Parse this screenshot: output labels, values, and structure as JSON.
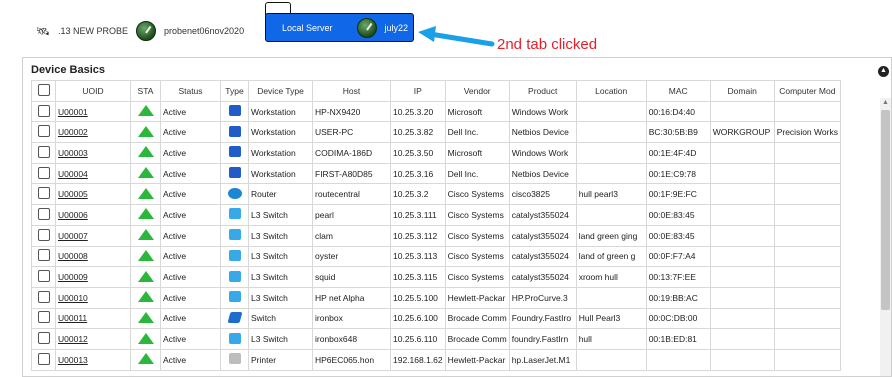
{
  "tabs": [
    {
      "label": ".13 NEW PROBE",
      "icon": "satellite-icon"
    },
    {
      "label": "probenet06nov2020",
      "icon": "gauge-icon"
    },
    {
      "label_left": "Local Server",
      "label_right": "july22",
      "icon": "gauge-icon",
      "active": true
    }
  ],
  "annotation": {
    "text": "2nd tab clicked",
    "color": "#e6202a",
    "arrow_color": "#1aa0e8"
  },
  "panel": {
    "title": "Device Basics"
  },
  "columns": [
    "UOID",
    "STA",
    "Status",
    "Type",
    "Device Type",
    "Host",
    "IP",
    "Vendor",
    "Product",
    "Location",
    "MAC",
    "Domain",
    "Computer Mod"
  ],
  "rows": [
    {
      "uoid": "U00001",
      "status": "Active",
      "type_icon": "workstation-icon",
      "device_type": "Workstation",
      "host": "HP-NX9420",
      "ip": "10.25.3.20",
      "vendor": "Microsoft",
      "product": "Windows Work",
      "location": "",
      "mac": "00:16:D4:40",
      "domain": "",
      "model": ""
    },
    {
      "uoid": "U00002",
      "status": "Active",
      "type_icon": "workstation-icon",
      "device_type": "Workstation",
      "host": "USER-PC",
      "ip": "10.25.3.82",
      "vendor": "Dell Inc.",
      "product": "Netbios Device",
      "location": "",
      "mac": "BC:30:5B:B9",
      "domain": "WORKGROUP",
      "model": "Precision Works"
    },
    {
      "uoid": "U00003",
      "status": "Active",
      "type_icon": "workstation-icon",
      "device_type": "Workstation",
      "host": "CODIMA-186D",
      "ip": "10.25.3.50",
      "vendor": "Microsoft",
      "product": "Windows Work",
      "location": "",
      "mac": "00:1E:4F:4D",
      "domain": "",
      "model": ""
    },
    {
      "uoid": "U00004",
      "status": "Active",
      "type_icon": "workstation-icon",
      "device_type": "Workstation",
      "host": "FIRST-A80D85",
      "ip": "10.25.3.16",
      "vendor": "Dell Inc.",
      "product": "Netbios Device",
      "location": "",
      "mac": "00:1E:C9:78",
      "domain": "",
      "model": ""
    },
    {
      "uoid": "U00005",
      "status": "Active",
      "type_icon": "router-icon",
      "device_type": "Router",
      "host": "routecentral",
      "ip": "10.25.3.2",
      "vendor": "Cisco Systems",
      "product": "cisco3825",
      "location": "hull pearl3",
      "mac": "00:1F:9E:FC",
      "domain": "",
      "model": ""
    },
    {
      "uoid": "U00006",
      "status": "Active",
      "type_icon": "l3-switch-icon",
      "device_type": "L3 Switch",
      "host": "pearl",
      "ip": "10.25.3.111",
      "vendor": "Cisco Systems",
      "product": "catalyst355024",
      "location": "",
      "mac": "00:0E:83:45",
      "domain": "",
      "model": ""
    },
    {
      "uoid": "U00007",
      "status": "Active",
      "type_icon": "l3-switch-icon",
      "device_type": "L3 Switch",
      "host": "clam",
      "ip": "10.25.3.112",
      "vendor": "Cisco Systems",
      "product": "catalyst355024",
      "location": "land green ging",
      "mac": "00:0E:83:45",
      "domain": "",
      "model": ""
    },
    {
      "uoid": "U00008",
      "status": "Active",
      "type_icon": "l3-switch-icon",
      "device_type": "L3 Switch",
      "host": "oyster",
      "ip": "10.25.3.113",
      "vendor": "Cisco Systems",
      "product": "catalyst355024",
      "location": "land of green g",
      "mac": "00:0F:F7:A4",
      "domain": "",
      "model": ""
    },
    {
      "uoid": "U00009",
      "status": "Active",
      "type_icon": "l3-switch-icon",
      "device_type": "L3 Switch",
      "host": "squid",
      "ip": "10.25.3.115",
      "vendor": "Cisco Systems",
      "product": "catalyst355024",
      "location": "xroom hull",
      "mac": "00:13:7F:EE",
      "domain": "",
      "model": ""
    },
    {
      "uoid": "U00010",
      "status": "Active",
      "type_icon": "l3-switch-icon",
      "device_type": "L3 Switch",
      "host": "HP net Alpha",
      "ip": "10.25.5.100",
      "vendor": "Hewlett-Packar",
      "product": "HP.ProCurve.3",
      "location": "",
      "mac": "00:19:BB:AC",
      "domain": "",
      "model": ""
    },
    {
      "uoid": "U00011",
      "status": "Active",
      "type_icon": "switch-icon",
      "device_type": "Switch",
      "host": "ironbox",
      "ip": "10.25.6.100",
      "vendor": "Brocade Comm",
      "product": "Foundry.FastIro",
      "location": "Hull Pearl3",
      "mac": "00:0C:DB:00",
      "domain": "",
      "model": ""
    },
    {
      "uoid": "U00012",
      "status": "Active",
      "type_icon": "l3-switch-icon",
      "device_type": "L3 Switch",
      "host": "ironbox648",
      "ip": "10.25.6.110",
      "vendor": "Brocade Comm",
      "product": "foundry.FastIrn",
      "location": "hull",
      "mac": "00:1B:ED:81",
      "domain": "",
      "model": ""
    },
    {
      "uoid": "U00013",
      "status": "Active",
      "type_icon": "printer-icon",
      "device_type": "Printer",
      "host": "HP6EC065.hon",
      "ip": "192.168.1.62",
      "vendor": "Hewlett-Packar",
      "product": "hp.LaserJet.M1",
      "location": "",
      "mac": "",
      "domain": "",
      "model": ""
    }
  ]
}
